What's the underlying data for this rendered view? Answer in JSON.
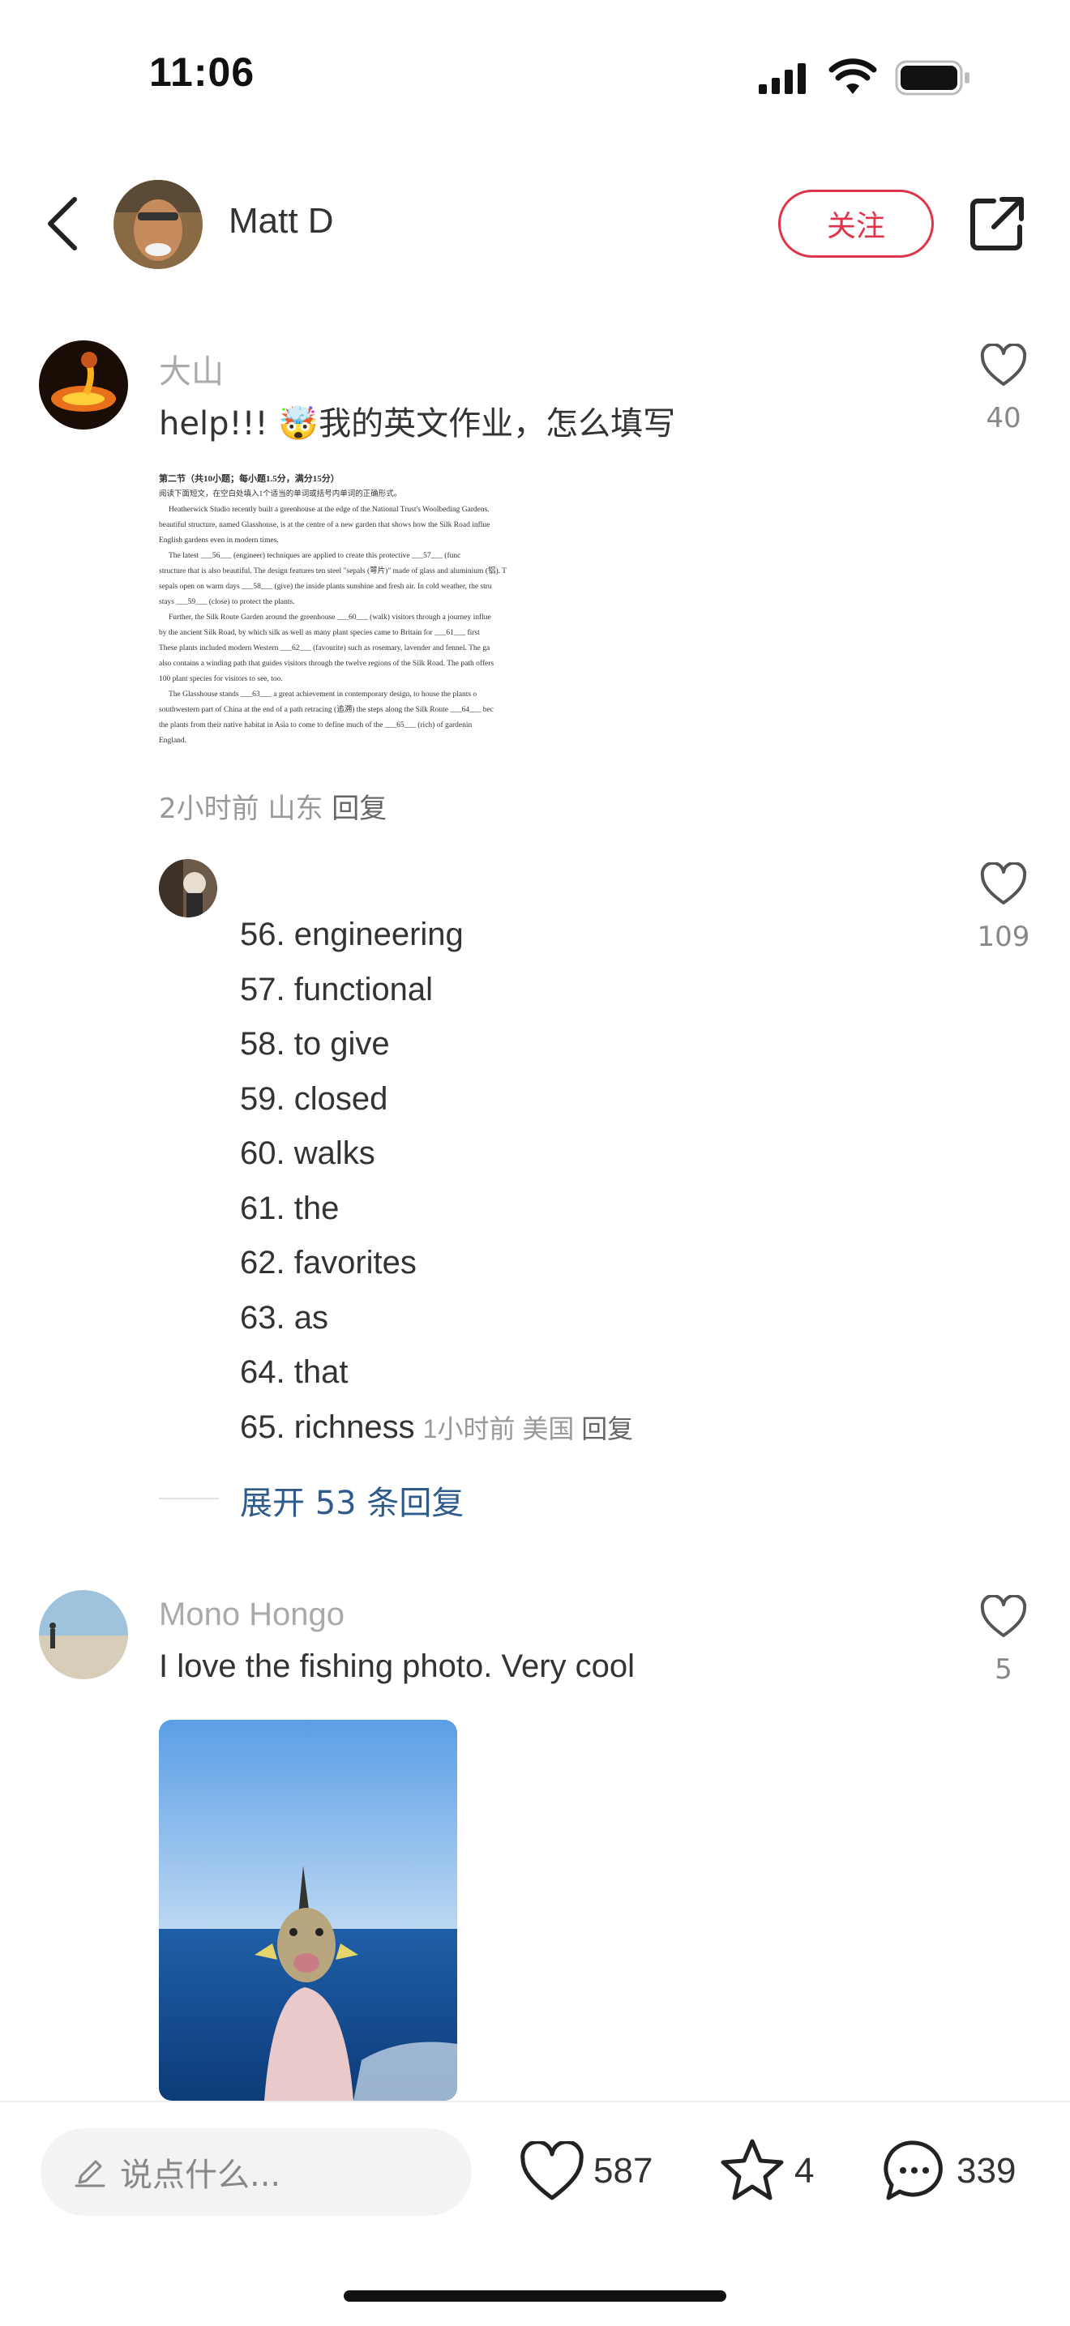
{
  "status_bar": {
    "time": "11:06"
  },
  "header": {
    "username": "Matt D",
    "follow_label": "关注"
  },
  "comments": [
    {
      "name": "大山",
      "text": "help!!! 🤯我的英文作业，怎么填写",
      "likes": "40",
      "meta": {
        "time": "2小时前",
        "location": "山东",
        "reply": "回复"
      },
      "image_doc": {
        "heading": "第二节（共10小题；每小题1.5分，满分15分）",
        "lines": [
          "阅读下面短文，在空白处填入1个适当的单词或括号内单词的正确形式。",
          "Heatherwick Studio recently built a greenhouse at the edge of the National Trust's Woolbeding Gardens.",
          "beautiful structure, named Glasshouse, is at the centre of a new garden that shows how the Silk Road influe",
          "English gardens even in modern times.",
          "The latest ___56___ (engineer) techniques are applied to create this protective ___57___ (func",
          "structure that is also beautiful. The design features ten steel \"sepals (萼片)\" made of glass and aluminium (铝). T",
          "sepals open on warm days ___58___ (give) the inside plants sunshine and fresh air. In cold weather, the stru",
          "stays ___59___ (close) to protect the plants.",
          "Further, the Silk Route Garden around the greenhouse ___60___ (walk) visitors through a journey influe",
          "by the ancient Silk Road, by which silk as well as many plant species came to Britain for ___61___ first",
          "These plants included modern Western ___62___ (favourite) such as rosemary, lavender and fennel. The ga",
          "also contains a winding path that guides visitors through the twelve regions of the Silk Road. The path offers",
          "100 plant species for visitors to see, too.",
          "The Glasshouse stands ___63___ a great achievement in contemporary design, to house the plants o",
          "southwestern part of China at the end of a path retracing (追溯) the steps along the Silk Route ___64___ bec",
          "the plants from their native habitat in Asia to come to define much of the ___65___ (rich) of gardenin",
          "England."
        ]
      }
    }
  ],
  "reply": {
    "likes": "109",
    "answers": [
      "56. engineering",
      "57. functional",
      "58. to give",
      "59. closed",
      "60. walks",
      "61. the",
      "62. favorites",
      "63. as",
      "64. that",
      "65. richness"
    ],
    "meta": {
      "time": "1小时前",
      "location": "美国",
      "reply": "回复"
    },
    "expand_label": "展开 53 条回复"
  },
  "comment2": {
    "name": "Mono Hongo",
    "text": "I love the fishing photo. Very cool",
    "likes": "5"
  },
  "bottom_bar": {
    "input_placeholder": "说点什么...",
    "likes": "587",
    "stars": "4",
    "comments": "339"
  },
  "colors": {
    "accent": "#e0344a",
    "link": "#2f5b8c"
  }
}
